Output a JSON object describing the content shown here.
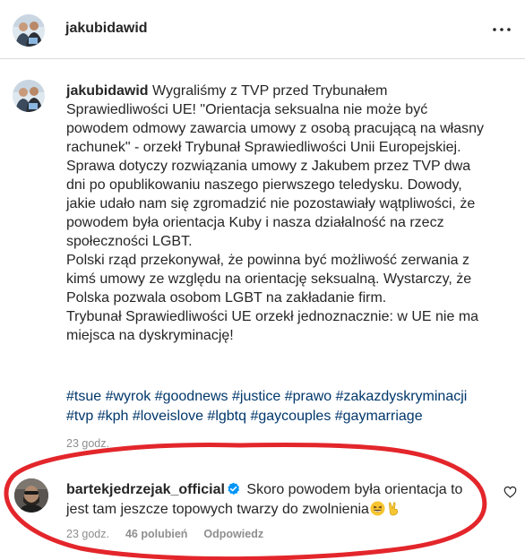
{
  "header": {
    "username": "jakubidawid",
    "more_icon": "more-horizontal-icon"
  },
  "post": {
    "author": "jakubidawid",
    "caption_text": " Wygraliśmy z TVP przed Trybunałem Sprawiedliwości UE! \"Orientacja seksualna nie może być powodem odmowy zawarcia umowy z osobą pracującą na własny rachunek\" - orzekł Trybunał Sprawiedliwości Unii Europejskiej.\nSprawa dotyczy rozwiązania umowy z Jakubem przez TVP dwa dni po opublikowaniu naszego pierwszego teledysku. Dowody, jakie udało nam się zgromadzić nie pozostawiały wątpliwości, że powodem była orientacja Kuby i nasza działalność na rzecz społeczności LGBT.\nPolski rząd przekonywał, że powinna być możliwość zerwania z kimś umowy ze względu na orientację seksualną. Wystarczy, że Polska pozwala osobom LGBT na zakładanie firm.\nTrybunał Sprawiedliwości UE orzekł jednoznacznie: w UE nie ma miejsca na dyskryminację!",
    "hashtags_line1": "#tsue #wyrok #goodnews #justice #prawo #zakazdyskryminacji",
    "hashtags_line2": "#tvp #kph #loveislove #lgbtq #gaycouples #gaymarriage",
    "timestamp": "23 godz."
  },
  "comment": {
    "author": "bartekjedrzejak_official",
    "text": " Skoro powodem była orientacja to jest tam jeszcze topowych twarzy do zwolnienia",
    "timestamp": "23 godz.",
    "likes": "46 polubień",
    "reply_label": "Odpowiedz"
  },
  "colors": {
    "text": "#262626",
    "secondary": "#8e8e8e",
    "hashtag": "#00376b",
    "verified": "#0095f6",
    "annotation": "#e3262b"
  }
}
